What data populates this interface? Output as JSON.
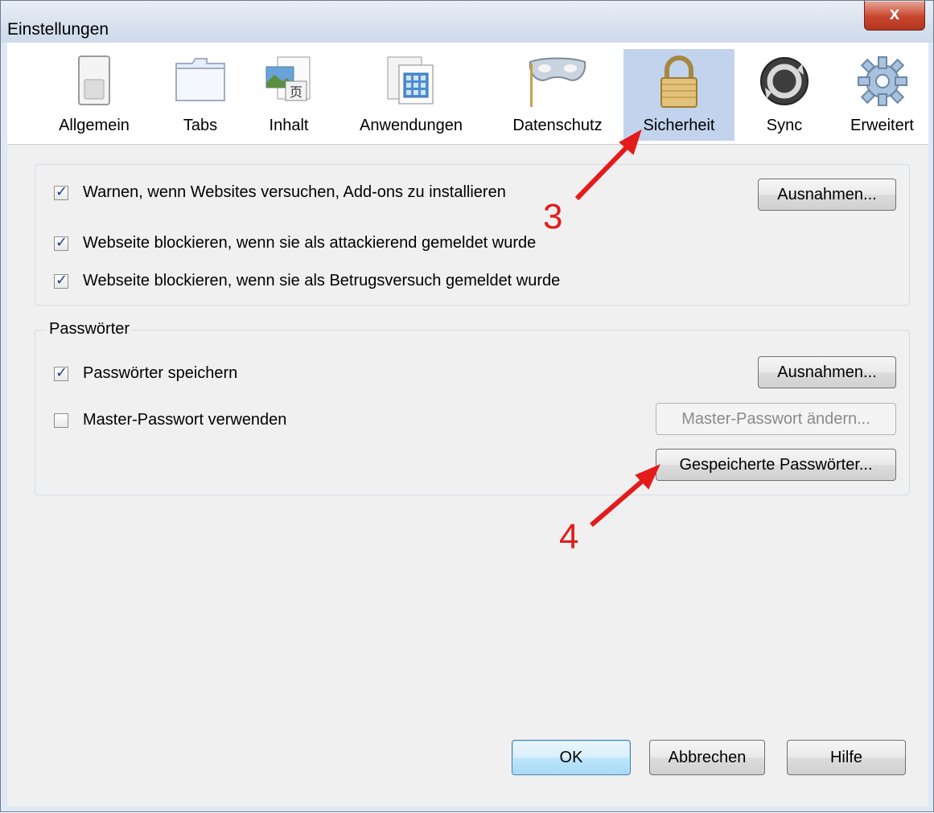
{
  "window": {
    "title": "Einstellungen",
    "close_glyph": "x"
  },
  "toolbar": {
    "items": [
      {
        "label": "Allgemein",
        "icon": "switch-icon"
      },
      {
        "label": "Tabs",
        "icon": "folder-tabs-icon"
      },
      {
        "label": "Inhalt",
        "icon": "content-image-icon"
      },
      {
        "label": "Anwendungen",
        "icon": "applications-icon"
      },
      {
        "label": "Datenschutz",
        "icon": "mask-icon"
      },
      {
        "label": "Sicherheit",
        "icon": "padlock-icon",
        "selected": true
      },
      {
        "label": "Sync",
        "icon": "sync-icon"
      },
      {
        "label": "Erweitert",
        "icon": "gear-icon"
      }
    ]
  },
  "security": {
    "warn_addons": {
      "label": "Warnen, wenn Websites versuchen, Add-ons zu installieren",
      "checked": true
    },
    "exceptions_label": "Ausnahmen...",
    "block_attack": {
      "label": "Webseite blockieren, wenn sie als attackierend gemeldet wurde",
      "checked": true
    },
    "block_forgery": {
      "label": "Webseite blockieren, wenn sie als Betrugsversuch gemeldet wurde",
      "checked": true
    }
  },
  "passwords": {
    "group_label": "Passwörter",
    "save": {
      "label": "Passwörter speichern",
      "checked": true
    },
    "exceptions_label": "Ausnahmen...",
    "master": {
      "label": "Master-Passwort verwenden",
      "checked": false
    },
    "change_master_label": "Master-Passwort ändern...",
    "saved_label": "Gespeicherte Passwörter..."
  },
  "footer": {
    "ok": "OK",
    "cancel": "Abbrechen",
    "help": "Hilfe"
  },
  "annotations": {
    "step3": "3",
    "step4": "4",
    "color": "#e31b1b"
  }
}
